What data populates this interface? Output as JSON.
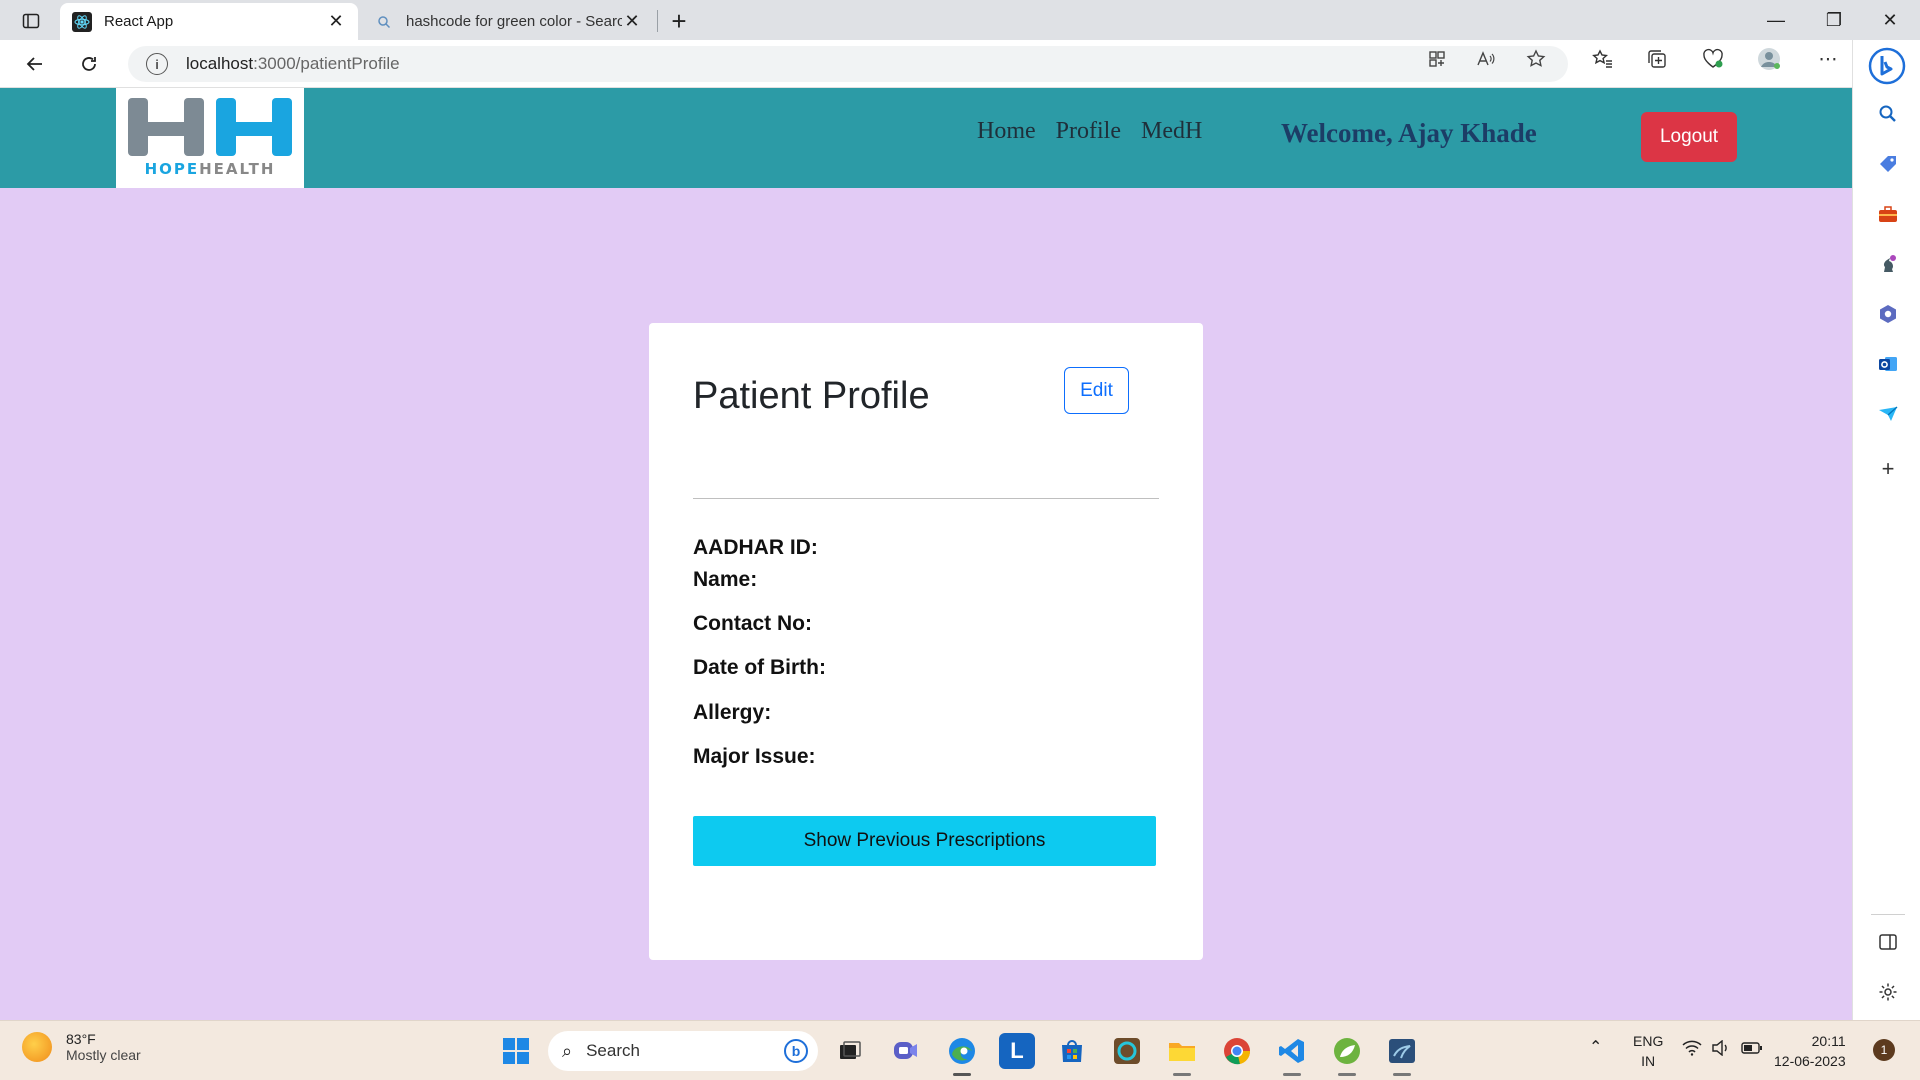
{
  "browser": {
    "tabs": [
      {
        "title": "React App",
        "active": true
      },
      {
        "title": "hashcode for green color - Searc",
        "active": false
      }
    ],
    "new_tab": "+",
    "window_controls": {
      "minimize": "—",
      "restore": "❐",
      "close": "✕"
    },
    "url_host": "localhost",
    "url_path": ":3000/patientProfile"
  },
  "header": {
    "logo": {
      "left": "HOPE",
      "right": "HEALTH"
    },
    "nav": [
      {
        "label": "Home"
      },
      {
        "label": "Profile"
      },
      {
        "label": "MedH"
      }
    ],
    "welcome": "Welcome, Ajay Khade",
    "logout_label": "Logout"
  },
  "profile": {
    "title": "Patient Profile",
    "edit_label": "Edit",
    "fields": [
      {
        "label": "AADHAR ID:",
        "value": ""
      },
      {
        "label": "Name:",
        "value": ""
      },
      {
        "label": "Contact No:",
        "value": ""
      },
      {
        "label": "Date of Birth:",
        "value": ""
      },
      {
        "label": "Allergy:",
        "value": ""
      },
      {
        "label": "Major Issue:",
        "value": ""
      }
    ],
    "prescriptions_label": "Show Previous Prescriptions"
  },
  "taskbar": {
    "weather_temp": "83°F",
    "weather_desc": "Mostly clear",
    "search_placeholder": "Search",
    "language": "ENG",
    "region": "IN",
    "time": "20:11",
    "date": "12-06-2023",
    "notification_count": "1"
  },
  "colors": {
    "header": "#2c9ba6",
    "page_bg": "#e2cbf5",
    "logout": "#dc3545",
    "edit": "#0d6efd",
    "prescriptions": "#0dcaf0"
  }
}
